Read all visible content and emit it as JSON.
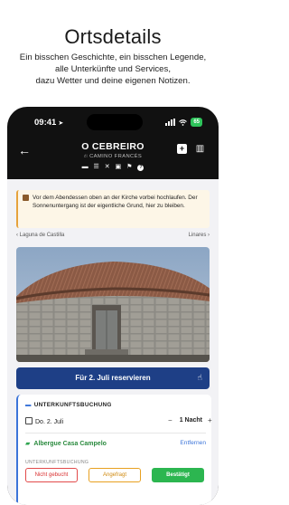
{
  "promo": {
    "title": "Ortsdetails",
    "subtitle_lines": [
      "Ein bisschen Geschichte, ein bisschen Legende,",
      "alle Unterkünfte und Services,",
      "dazu Wetter und deine eigenen Notizen."
    ]
  },
  "status_bar": {
    "time": "09:41",
    "battery": "65"
  },
  "header": {
    "title": "O CEBREIRO",
    "route": "CAMINO FRANCÉS",
    "amenity_icons": [
      "bed-icon",
      "bunk-bed-icon",
      "restaurant-icon",
      "shop-icon",
      "bar-icon",
      "help-icon"
    ]
  },
  "note": {
    "text": "Vor dem Abendessen oben an der Kirche vorbei hochlaufen. Der Sonnenuntergang ist der eigentliche Grund, hier zu bleiben."
  },
  "nav": {
    "prev": "Laguna de Castilla",
    "next": "Linares"
  },
  "reserve_button": {
    "label": "Für 2. Juli reservieren"
  },
  "booking": {
    "heading": "UNTERKUNFTSBUCHUNG",
    "date": "Do. 2. Juli",
    "nights": "1 Nacht",
    "accommodation": "Albergue Casa Campelo",
    "remove_label": "Entfernen",
    "status_heading": "UNTERKUNFTSBUCHUNG",
    "statuses": [
      "Nicht gebucht",
      "Angefragt",
      "Bestätigt"
    ],
    "selected_status": "Bestätigt"
  },
  "colors": {
    "primary": "#1e3f86",
    "accent_blue": "#3b74d9",
    "confirmed_green": "#2cb650",
    "not_booked_red": "#e24a4a",
    "requested_orange": "#e8a020",
    "note_bg": "#fdf6e7"
  }
}
